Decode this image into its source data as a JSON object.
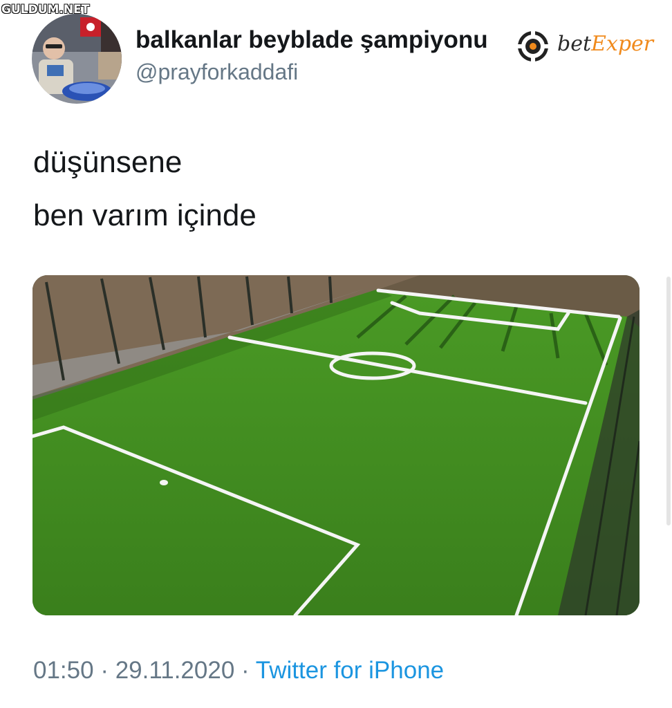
{
  "watermark": "GULDUM.NET",
  "tweet": {
    "author": {
      "name": "balkanlar beyblade şampiyonu",
      "handle": "@prayforkaddafi"
    },
    "text_lines": [
      "düşünsene",
      "ben varım içinde"
    ],
    "time": "01:50",
    "date": "29.11.2020",
    "separator": "·",
    "source": "Twitter for iPhone"
  },
  "ad": {
    "icon": "chip-icon",
    "text_part1": "bet",
    "text_part2": "Exper",
    "colors": {
      "dark": "#2b2b2b",
      "accent": "#f08a1c"
    }
  },
  "colors": {
    "name": "#14171a",
    "muted": "#657786",
    "link": "#1b95e0",
    "turf": "#3f8a1f"
  },
  "media": {
    "subject": "football-pitch-image"
  }
}
